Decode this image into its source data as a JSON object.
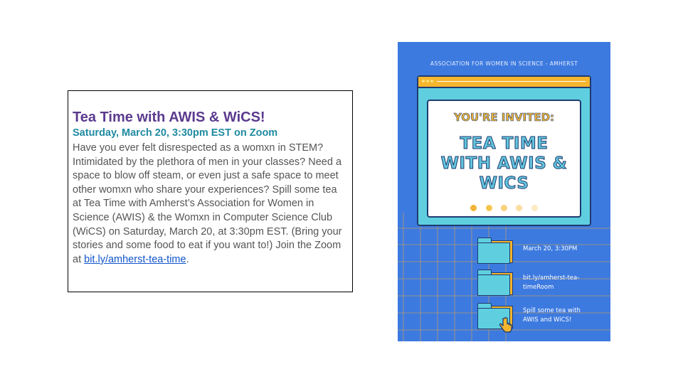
{
  "card": {
    "title": "Tea Time with AWIS & WiCS!",
    "subtitle": "Saturday, March 20, 3:30pm EST on Zoom",
    "body": "Have you ever felt disrespected as a womxn in STEM? Intimidated by the plethora of men in your classes? Need a space to blow off steam, or even just a safe space to meet other womxn who share your experiences? Spill some tea at Tea Time with Amherst’s Association for Women in Science (AWIS) & the Womxn in Computer Science Club (WiCS) on Saturday, March 20, at 3:30pm EST. (Bring your stories and some food to eat if you want to!) Join the Zoom at ",
    "link": "bit.ly/amherst-tea-time",
    "end": "."
  },
  "poster": {
    "header": "ASSOCIATION FOR WOMEN IN SCIENCE - AMHERST",
    "invited": "YOU'RE INVITED:",
    "line1": "TEA TIME",
    "line2": "WITH AWIS &",
    "line3": "WICS",
    "items": [
      {
        "label1": "March 20, 3:30PM",
        "label2": ""
      },
      {
        "label1": "bit.ly/amherst-tea-",
        "label2": "timeRoom"
      },
      {
        "label1": "Spill some tea with",
        "label2": "AWIS and WiCS!"
      }
    ],
    "colors": {
      "background": "#3d7ae0",
      "window": "#5fcfe0",
      "titlebar": "#f5b62e",
      "accent": "#f0b437"
    },
    "dot_colors": [
      "#f0b437",
      "#f5c64f",
      "#f7d27a",
      "#f9dea0",
      "#fbeac4"
    ],
    "cursor_icon": "hand-pointer-icon"
  }
}
